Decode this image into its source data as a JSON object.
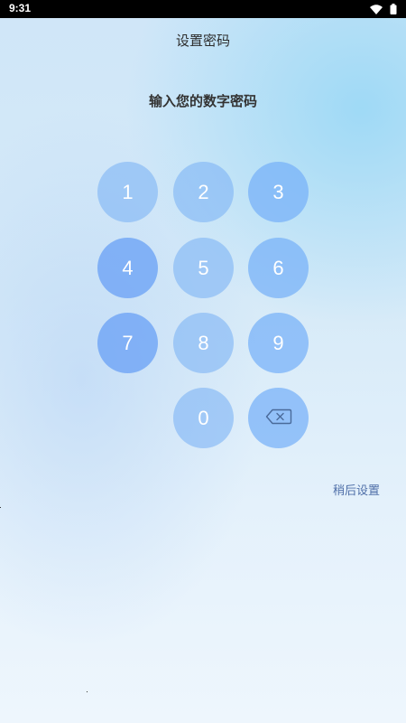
{
  "status_bar": {
    "time": "9:31",
    "icons": [
      "wifi-icon",
      "battery-icon"
    ]
  },
  "header": {
    "title": "设置密码"
  },
  "prompt": "输入您的数字密码",
  "keypad": {
    "keys": [
      "1",
      "2",
      "3",
      "4",
      "5",
      "6",
      "7",
      "8",
      "9",
      "0"
    ],
    "backspace_icon": "backspace-icon"
  },
  "footer": {
    "later_label": "稍后设置"
  },
  "colors": {
    "key_fill": "#74aaf5",
    "key_text": "#ffffff",
    "link": "#4f6fa8",
    "status_bar": "#000000"
  }
}
